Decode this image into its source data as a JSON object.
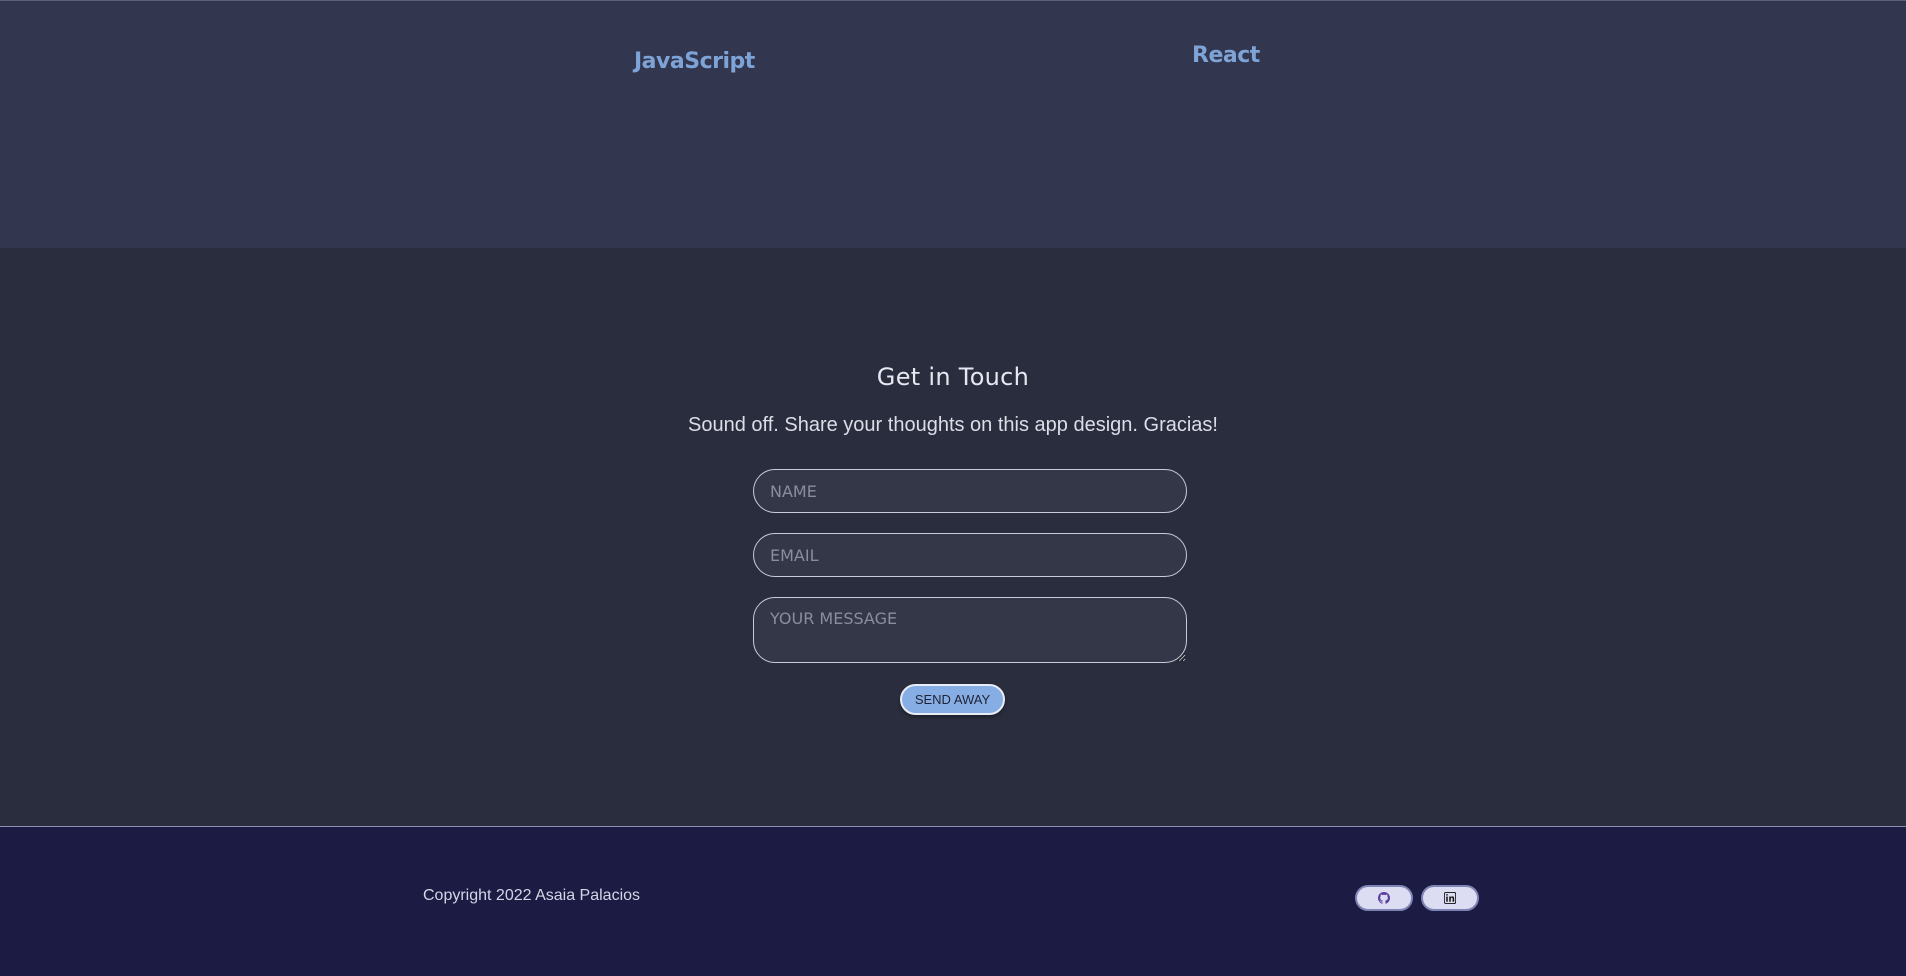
{
  "skills": {
    "items": [
      "JavaScript",
      "React"
    ]
  },
  "contact": {
    "title": "Get in Touch",
    "subtitle": "Sound off. Share your thoughts on this app design. Gracias!",
    "name_placeholder": "NAME",
    "email_placeholder": "EMAIL",
    "message_placeholder": "YOUR MESSAGE",
    "send_label": "SEND AWAY"
  },
  "footer": {
    "copyright": "Copyright 2022 Asaia Palacios",
    "social": [
      {
        "icon": "github-icon"
      },
      {
        "icon": "linkedin-icon"
      }
    ]
  },
  "colors": {
    "skills_bg": "#32364f",
    "contact_bg": "#292d3d",
    "footer_bg": "#1b1b44",
    "accent": "#86aee5",
    "skill_text": "#7ea3d6"
  }
}
